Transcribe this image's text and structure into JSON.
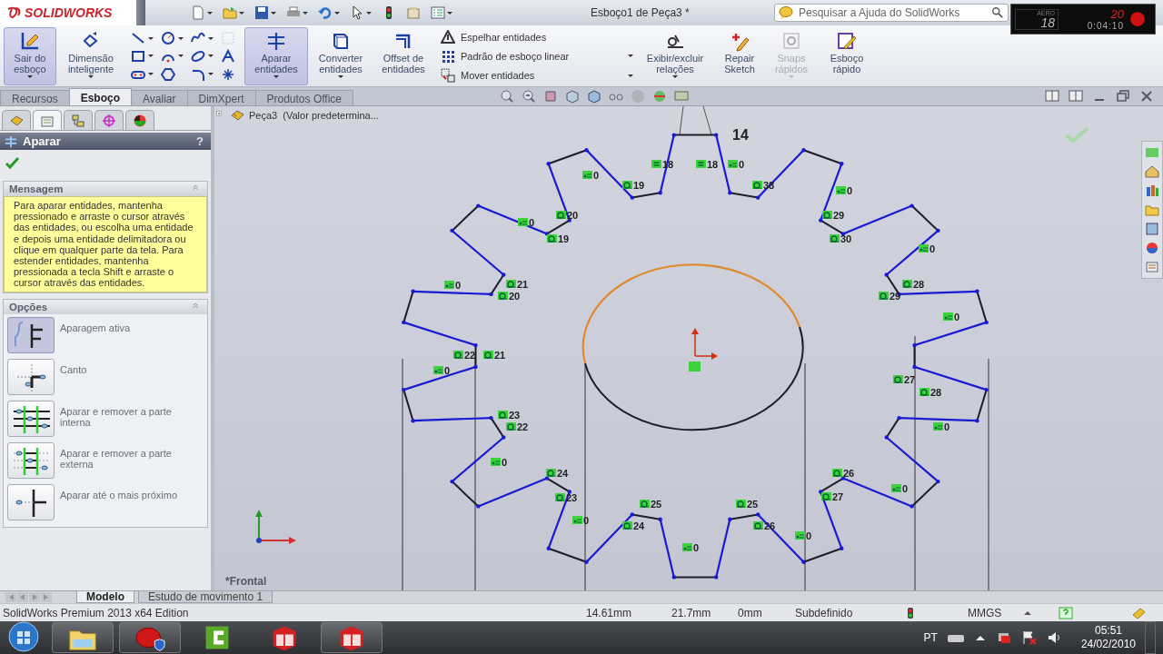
{
  "app": {
    "logo": "SOLIDWORKS",
    "title": "Esboço1 de Peça3 *",
    "search_placeholder": "Pesquisar a Ajuda do SolidWorks"
  },
  "recorder": {
    "mode": "AERO",
    "fps": "18",
    "frames": "20",
    "elapsed": "0:04:10"
  },
  "ribbon": [
    {
      "kind": "large",
      "label": "Sair do esboço",
      "selected": true,
      "disabled": false
    },
    {
      "kind": "large",
      "label": "Dimensão inteligente",
      "selected": false,
      "disabled": false
    },
    {
      "kind": "tools"
    },
    {
      "kind": "large",
      "label": "Aparar entidades",
      "selected": true,
      "disabled": false
    },
    {
      "kind": "large",
      "label": "Converter entidades",
      "selected": false,
      "disabled": false
    },
    {
      "kind": "large",
      "label": "Offset de entidades",
      "selected": false,
      "disabled": false
    },
    {
      "kind": "list",
      "entries": [
        "Espelhar entidades",
        "Padrão de esboço linear",
        "Mover entidades"
      ]
    },
    {
      "kind": "large",
      "label": "Exibir/excluir relações",
      "selected": false,
      "disabled": false
    },
    {
      "kind": "large",
      "label": "Repair Sketch",
      "selected": false,
      "disabled": false
    },
    {
      "kind": "large",
      "label": "Snaps rápidos",
      "selected": false,
      "disabled": true
    },
    {
      "kind": "large",
      "label": "Esboço rápido",
      "selected": false,
      "disabled": false
    }
  ],
  "command_tabs": [
    {
      "label": "Recursos",
      "selected": false
    },
    {
      "label": "Esboço",
      "selected": true
    },
    {
      "label": "Avaliar",
      "selected": false
    },
    {
      "label": "DimXpert",
      "selected": false
    },
    {
      "label": "Produtos Office",
      "selected": false
    }
  ],
  "panel": {
    "tabs": [
      {
        "selected": false
      },
      {
        "selected": true
      },
      {
        "selected": false
      },
      {
        "selected": false
      },
      {
        "selected": false
      }
    ],
    "title": "Aparar",
    "help": "?",
    "message": {
      "title": "Mensagem",
      "text": "Para aparar entidades, mantenha pressionado e arraste o cursor através das entidades, ou escolha uma entidade e depois uma entidade delimitadora ou clique em qualquer parte da tela. Para estender entidades, mantenha pressionada a tecla Shift e arraste o cursor através das entidades."
    },
    "options": {
      "title": "Opções",
      "items": [
        {
          "label": "Aparagem ativa",
          "selected": true
        },
        {
          "label": "Canto",
          "selected": false
        },
        {
          "label": "Aparar e remover a parte interna",
          "selected": false
        },
        {
          "label": "Aparar e remover a parte externa",
          "selected": false
        },
        {
          "label": "Aparar até o mais próximo",
          "selected": false
        }
      ]
    }
  },
  "canvas": {
    "tree_item": "Peça3  (Valor predetermina...",
    "view": "*Frontal",
    "dimension": "14",
    "relations": [
      {
        "kind": "equal",
        "label": "18"
      },
      {
        "kind": "equal",
        "label": "18"
      },
      {
        "kind": "coincident",
        "label": "0"
      },
      {
        "kind": "coincident",
        "label": "0"
      },
      {
        "kind": "tangent",
        "label": "19"
      },
      {
        "kind": "tangent",
        "label": "38"
      },
      {
        "kind": "coincident",
        "label": "0"
      },
      {
        "kind": "coincident",
        "label": "0"
      },
      {
        "kind": "tangent",
        "label": "20"
      },
      {
        "kind": "tangent",
        "label": "29"
      },
      {
        "kind": "tangent",
        "label": "19"
      },
      {
        "kind": "tangent",
        "label": "30"
      },
      {
        "kind": "coincident",
        "label": "0"
      },
      {
        "kind": "coincident",
        "label": "0"
      },
      {
        "kind": "tangent",
        "label": "21"
      },
      {
        "kind": "tangent",
        "label": "28"
      },
      {
        "kind": "tangent",
        "label": "20"
      },
      {
        "kind": "tangent",
        "label": "29"
      },
      {
        "kind": "coincident",
        "label": "0"
      },
      {
        "kind": "tangent",
        "label": "22"
      },
      {
        "kind": "tangent",
        "label": "21"
      },
      {
        "kind": "coincident",
        "label": "0"
      },
      {
        "kind": "tangent",
        "label": "27"
      },
      {
        "kind": "tangent",
        "label": "28"
      },
      {
        "kind": "tangent",
        "label": "23"
      },
      {
        "kind": "tangent",
        "label": "22"
      },
      {
        "kind": "coincident",
        "label": "0"
      },
      {
        "kind": "coincident",
        "label": "0"
      },
      {
        "kind": "tangent",
        "label": "24"
      },
      {
        "kind": "tangent",
        "label": "26"
      },
      {
        "kind": "tangent",
        "label": "23"
      },
      {
        "kind": "tangent",
        "label": "27"
      },
      {
        "kind": "coincident",
        "label": "0"
      },
      {
        "kind": "tangent",
        "label": "25"
      },
      {
        "kind": "tangent",
        "label": "25"
      },
      {
        "kind": "coincident",
        "label": "0"
      },
      {
        "kind": "tangent",
        "label": "24"
      },
      {
        "kind": "tangent",
        "label": "26"
      },
      {
        "kind": "coincident",
        "label": "0"
      },
      {
        "kind": "coincident",
        "label": "0"
      }
    ]
  },
  "bottom_tabs": [
    {
      "label": "Modelo",
      "selected": true
    },
    {
      "label": "Estudo de movimento 1",
      "selected": false
    }
  ],
  "status_bar": {
    "edition": "SolidWorks Premium 2013 x64 Edition",
    "x": "14.61mm",
    "y": "21.7mm",
    "z": "0mm",
    "state": "Subdefinido",
    "units": "MMGS"
  },
  "taskbar": {
    "apps": [
      {
        "running": true
      },
      {
        "running": true
      },
      {
        "running": false
      },
      {
        "running": false
      },
      {
        "running": true
      }
    ],
    "language": "PT",
    "time": "05:51",
    "date": "24/02/2010"
  }
}
